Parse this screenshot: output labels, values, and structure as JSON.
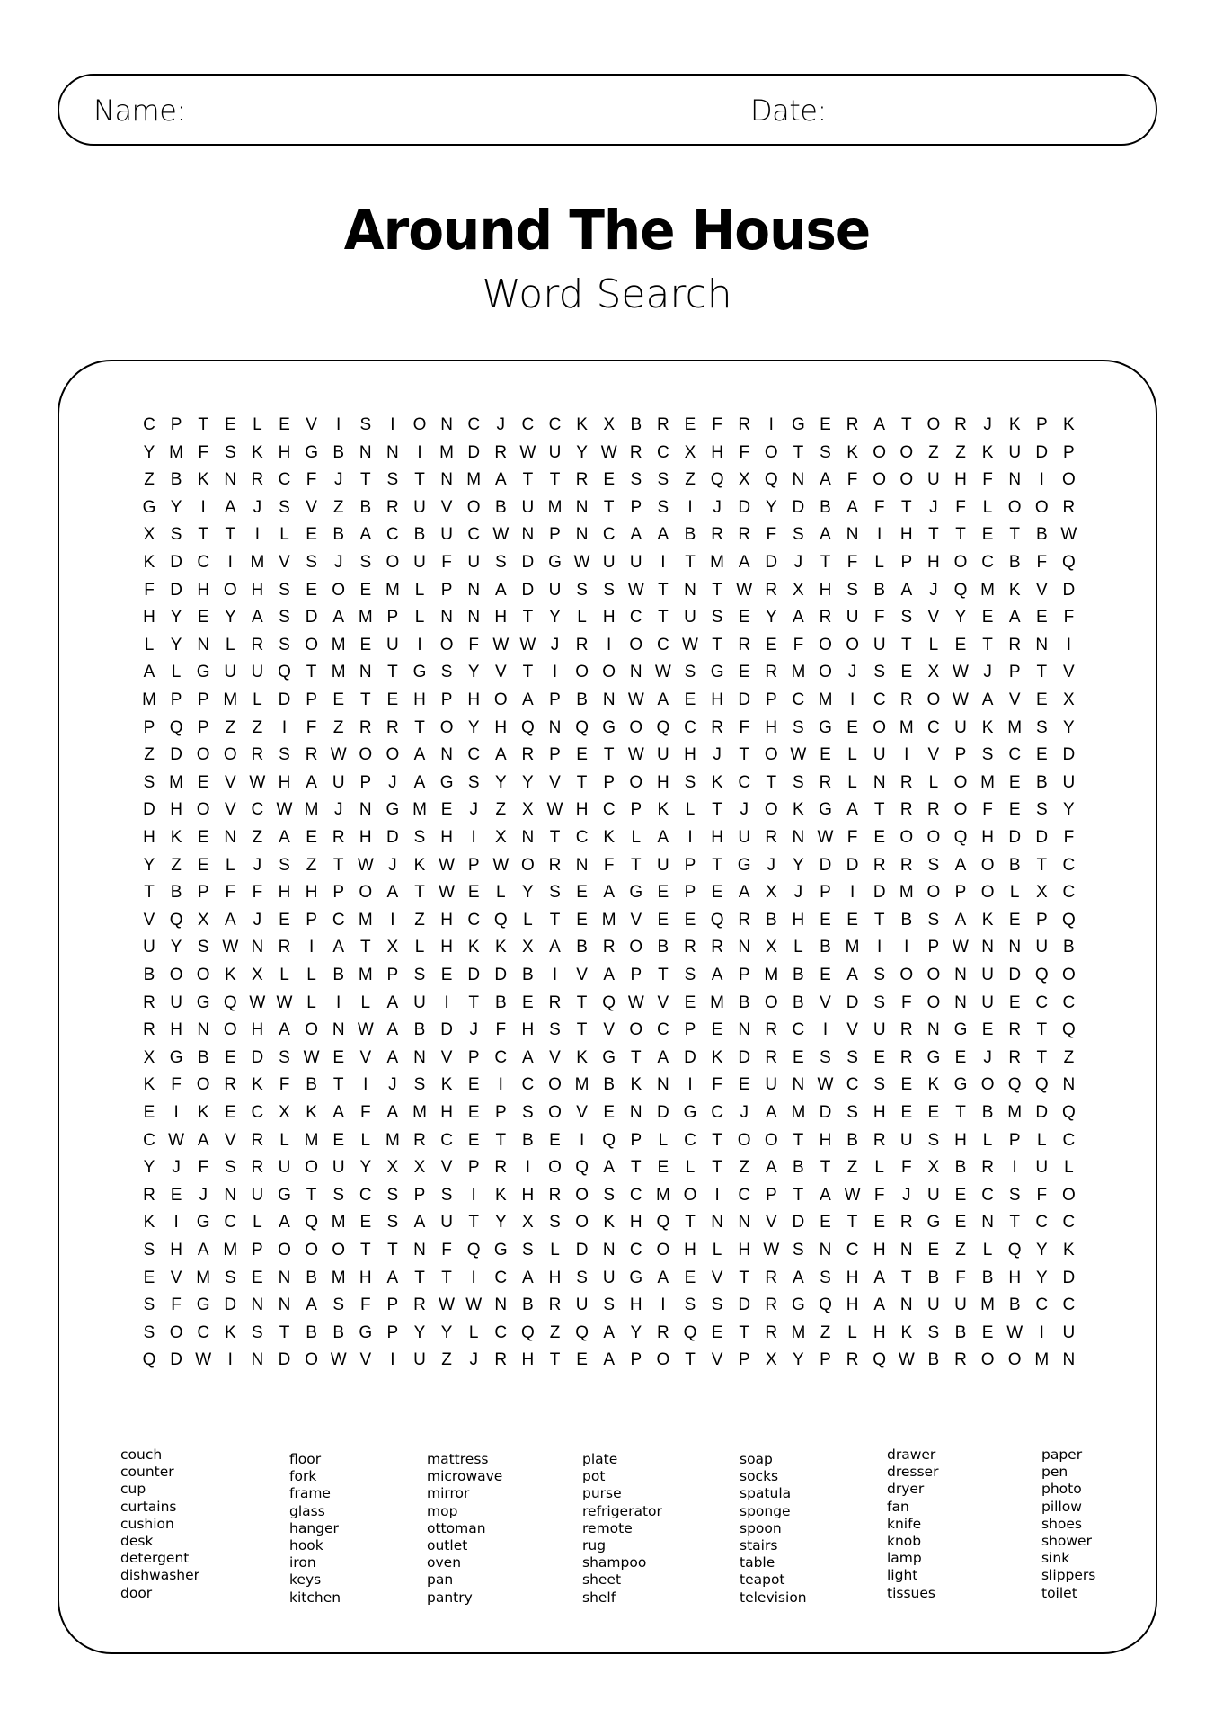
{
  "header": {
    "name_label": "Name:",
    "date_label": "Date:"
  },
  "title": "Around The House",
  "subtitle": "Word Search",
  "grid": [
    "CPTELEVISIONCJCCKXBREFRIGERATORJKPK",
    "YMFSKHGBNNIMDRWUYWRCXHFOTSKOOZZKUDP",
    "ZBKNRCFJTSTNMATTRESSZQXQNAFOOUHFNIO",
    "GYIAJSVZBRUVOBUMNTPSIJDYDBAFTJFLOOR",
    "XSTTILEBACBUCWNPNCAABRRFSANIHTTETBW",
    "KDCIMVSJSOUFUSDGWUUITMADJTFLPHOCBFQ",
    "FDHOHSEOEMLPNADUSSWTNTWRXHSBAJQMKVD",
    "HYEYASDAMPLNNHTYLHCTUSEYARUFSVYEAEF",
    "LYNLRSOMEUIOFWWJRIOCWTREFOOUTLETRNI",
    "ALGUUQTMNTGSYVTIOONWSGERMOJSEXWJPTV",
    "MPPMLDPETEHPHOAPBNWAEHDPCMICROWAVEX",
    "PQPZZIFZRRTOYHQNQGOQCRFHSGEOMCUKMSY",
    "ZDOORSRWOOANCARPETWUHJTOWELUIVPSCED",
    "SMEVWHAUPJAGSYYVTPOHSKCTSRLNRLOMEBU",
    "DHOVCWMJNGMEJZXWHCPKLTJOKGATRROFESY",
    "HKENZAERHDSHIXNTCKLAIHURNWFEOOQHDDF",
    "YZELJSZTWJKWPWORNFTUPTGJYDDRRSAOBTC",
    "TBPFFHHPOATWELYSEAGEPEAXJPIDMOPOLXC",
    "VQXAJEPCMIZHCQLTEMVEEQRBHEETBSAKEPQ",
    "UYSWNRIATXLHKKXABROBRRNXLBMIIPWNNUB",
    "BOOKXLLBMPSEDDBIVAPTSAPMBEASOONUDQO",
    "RUGQWWLILAUITBERTQWVEMBOBVDSFONUECC",
    "RHNOHAONWABDJFHSTVOCPENRCIVURNGERTQ",
    "XGBEDSWEVANVPCAVKGTADKDRESSERGEJRTZ",
    "KFORKFBTIJSKEICOMBKNIFEUNWCSEKGOQQN",
    "EIKECXKAFAMHEPSOVENDGCJAMDSHEETBMDQ",
    "CWAVRLMELMRCETBEIQPLCTOOTHBRUSHLPLC",
    "YJFSRUOUYXXVPRIOQATELTZABTZLFXBRIUL",
    "REJNUGTSCSPSIKHROSCMOICPTAWFJUECSFO",
    "KIGCLAQMESAUTYXSOKHQTNNVDETERGENTCC",
    "SHAMPOOOTTNFQGSLDNCOHLHWSNCHNEZLQYK",
    "EVMSENBMHATTICAHSUGAEVTRASHATBFBHYD",
    "SFGDNNASFPRWWNBRUSHISSDRGQHANUUMBCC",
    "SOCKSTBBGPYYLCQZQAYRQETRMZLHKSBEWIU",
    "QDWINDOWVIUZJRHTEAPOTVPXYPRQWBROOMN"
  ],
  "word_columns": [
    [
      "couch",
      "counter",
      "cup",
      "curtains",
      "cushion",
      "desk",
      "detergent",
      "dishwasher",
      "door"
    ],
    [
      "floor",
      "fork",
      "frame",
      "glass",
      "hanger",
      "hook",
      "iron",
      "keys",
      "kitchen"
    ],
    [
      "mattress",
      "microwave",
      "mirror",
      "mop",
      "ottoman",
      "outlet",
      "oven",
      "pan",
      "pantry"
    ],
    [
      "plate",
      "pot",
      "purse",
      "refrigerator",
      "remote",
      "rug",
      "shampoo",
      "sheet",
      "shelf"
    ],
    [
      "soap",
      "socks",
      "spatula",
      "sponge",
      "spoon",
      "stairs",
      "table",
      "teapot",
      "television"
    ],
    [
      "drawer",
      "dresser",
      "dryer",
      "fan",
      "knife",
      "knob",
      "lamp",
      "light",
      "tissues"
    ],
    [
      "paper",
      "pen",
      "photo",
      "pillow",
      "shoes",
      "shower",
      "sink",
      "slippers",
      "toilet"
    ]
  ]
}
